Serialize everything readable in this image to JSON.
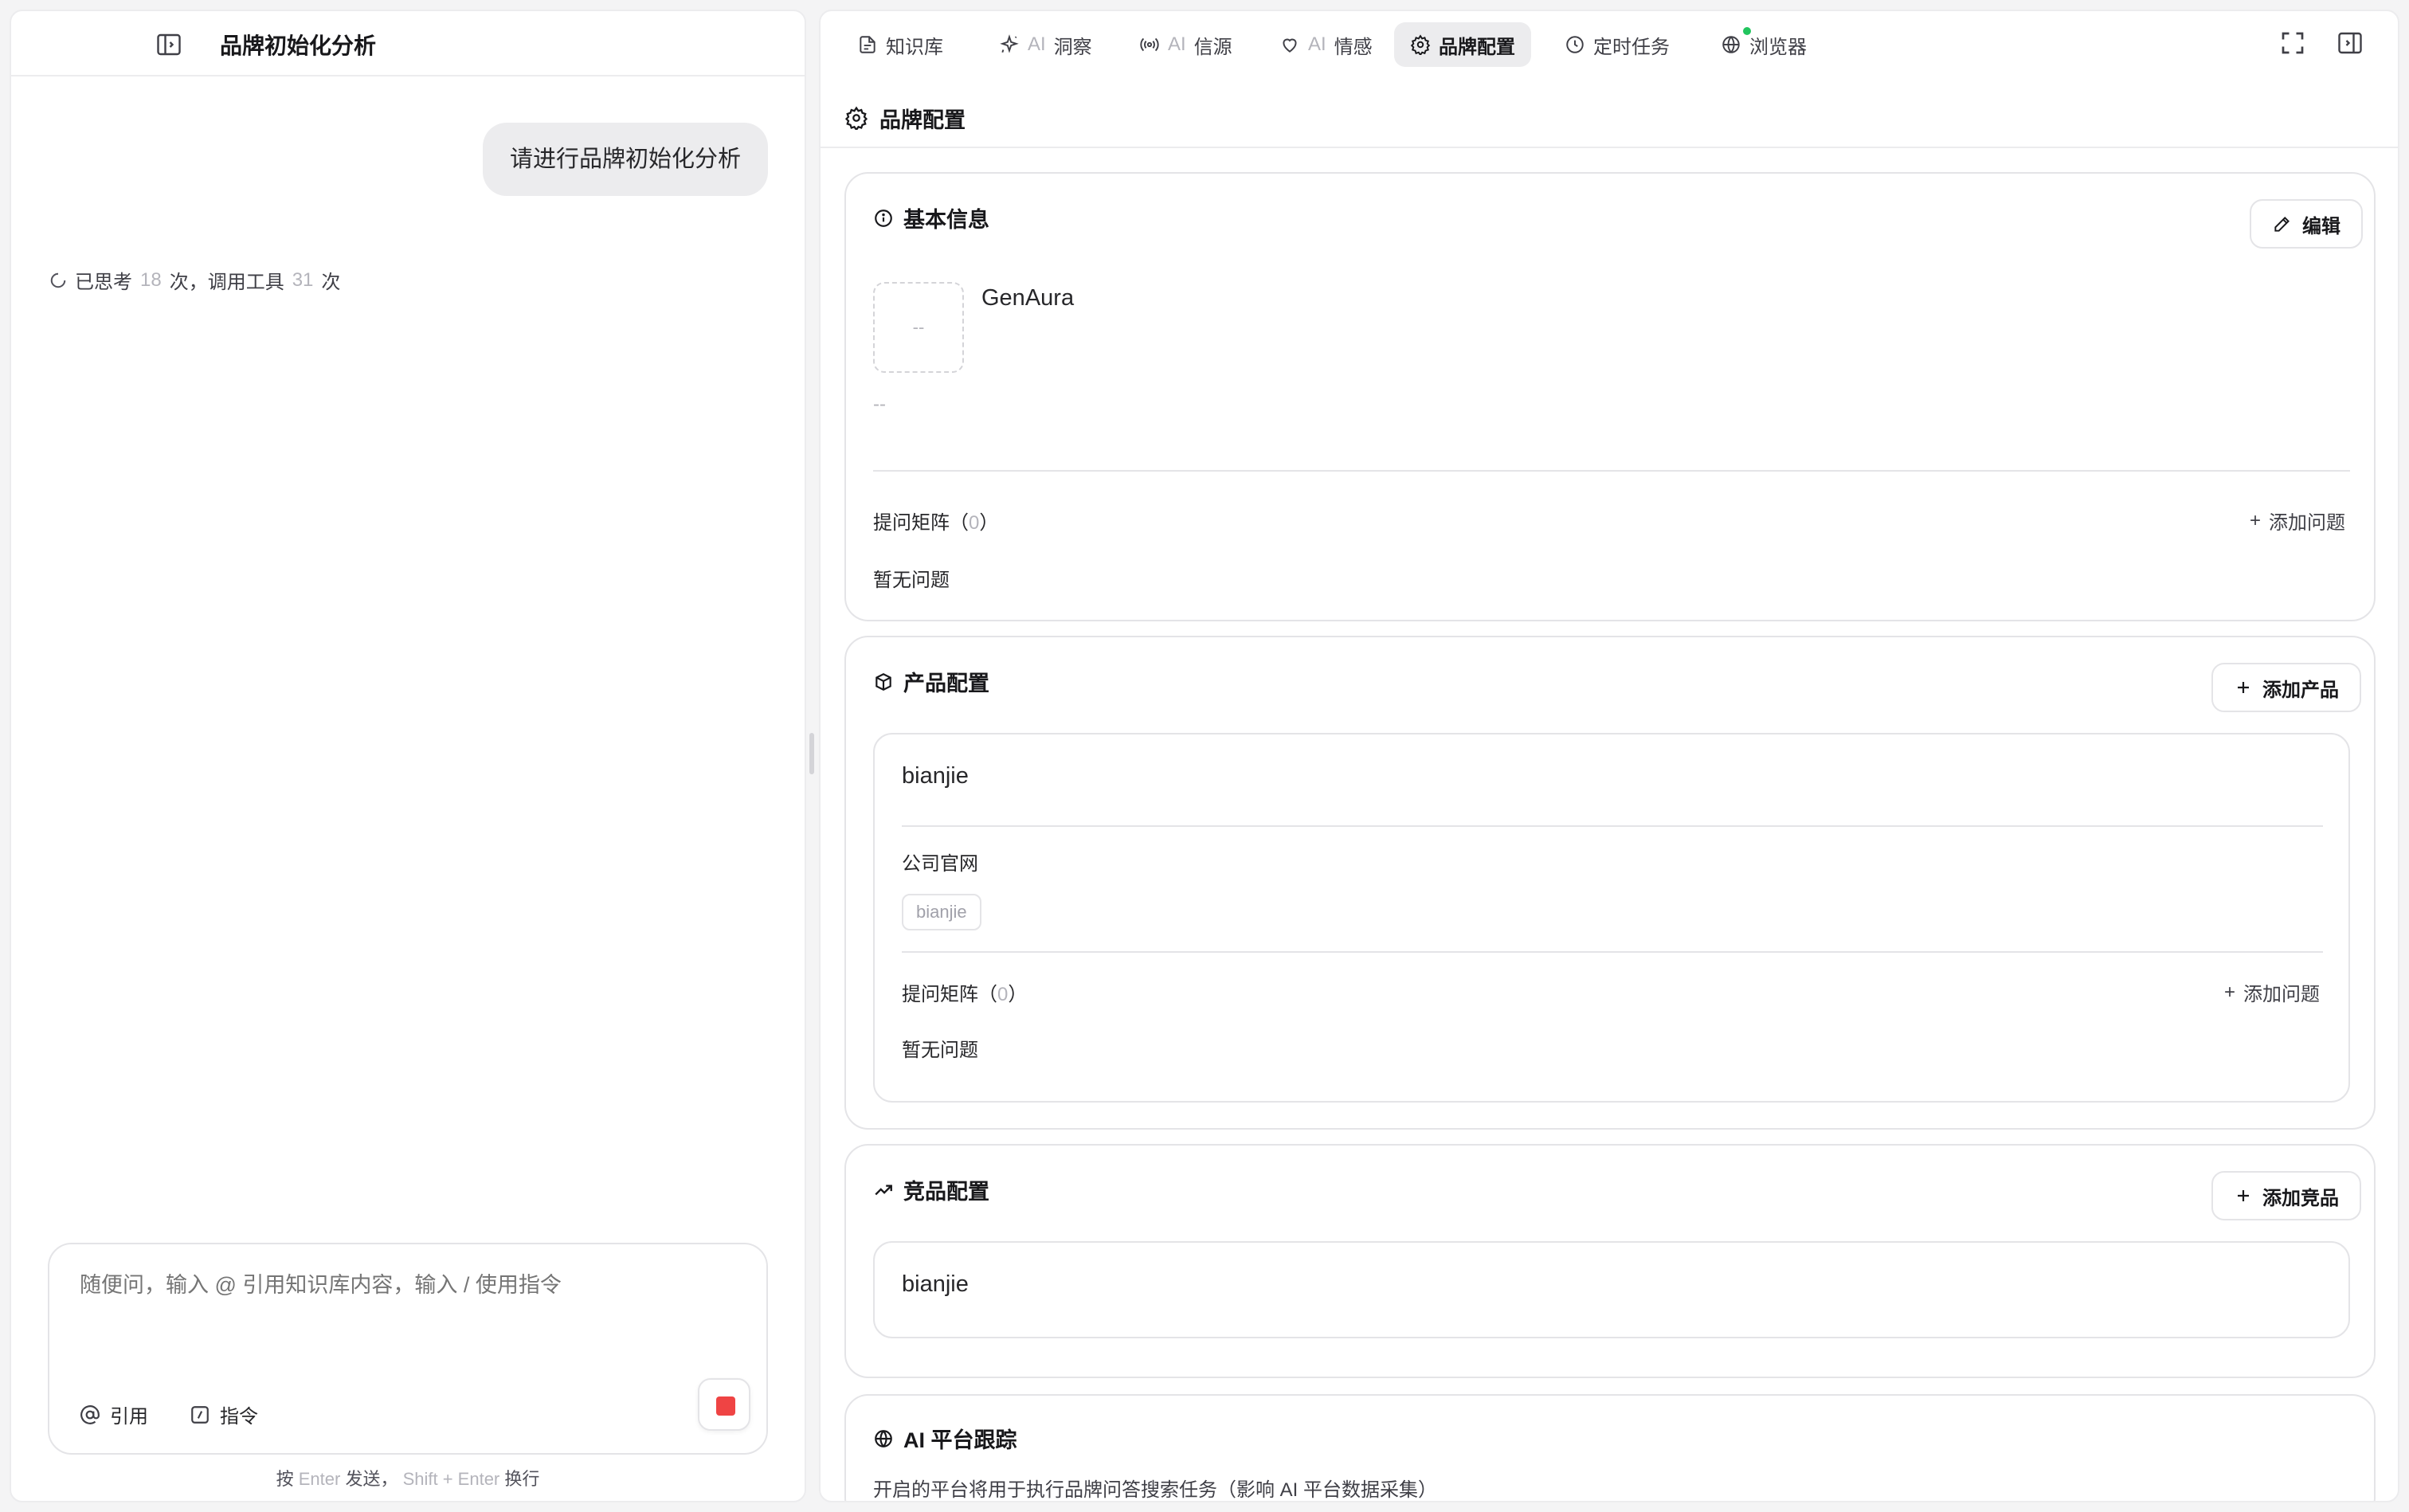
{
  "left": {
    "title": "品牌初始化分析",
    "user_message": "请进行品牌初始化分析",
    "status": {
      "thought_prefix": "已思考",
      "thought_count": "18",
      "thought_suffix": "次，调用工具",
      "tool_count": "31",
      "tool_suffix": "次"
    },
    "composer": {
      "placeholder": "随便问，输入 @ 引用知识库内容，输入 / 使用指令",
      "cite_label": "引用",
      "command_label": "指令"
    },
    "hint": {
      "p1": "按",
      "enter": "Enter",
      "p2": "发送，",
      "shift": "Shift + Enter",
      "p3": "换行"
    }
  },
  "tabs": [
    {
      "label": "知识库",
      "ai": "",
      "icon": "file-icon"
    },
    {
      "label": "洞察",
      "ai": "AI",
      "icon": "sparkle-icon"
    },
    {
      "label": "信源",
      "ai": "AI",
      "icon": "broadcast-icon"
    },
    {
      "label": "情感",
      "ai": "AI",
      "icon": "heart-icon"
    },
    {
      "label": "品牌配置",
      "ai": "",
      "icon": "gear-icon",
      "active": true
    },
    {
      "label": "定时任务",
      "ai": "",
      "icon": "clock-icon"
    },
    {
      "label": "浏览器",
      "ai": "",
      "icon": "globe-icon"
    }
  ],
  "page": {
    "title": "品牌配置"
  },
  "basic": {
    "title": "基本信息",
    "edit_label": "编辑",
    "logo_placeholder": "--",
    "brand_name": "GenAura",
    "brand_desc": "--",
    "matrix_label": "提问矩阵（",
    "matrix_count": "0",
    "matrix_close": "）",
    "add_question": "添加问题",
    "empty": "暂无问题"
  },
  "products": {
    "title": "产品配置",
    "add_label": "添加产品",
    "item": {
      "name": "bianjie",
      "website_label": "公司官网",
      "tag": "bianjie",
      "matrix_label": "提问矩阵（",
      "matrix_count": "0",
      "matrix_close": "）",
      "add_question": "添加问题",
      "empty": "暂无问题"
    }
  },
  "competitors": {
    "title": "竞品配置",
    "add_label": "添加竞品",
    "item_name": "bianjie"
  },
  "ai_platform": {
    "title": "AI 平台跟踪",
    "desc": "开启的平台将用于执行品牌问答搜索任务（影响 AI 平台数据采集）"
  },
  "colors": {
    "stop": "#ef4444",
    "active_tab": "#ececee",
    "online": "#22c55e"
  }
}
